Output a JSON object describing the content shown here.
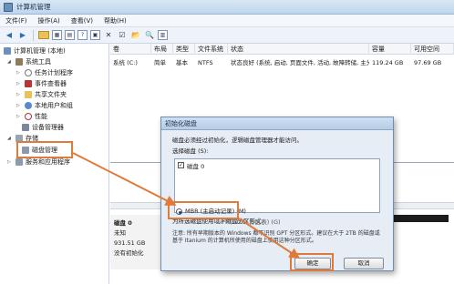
{
  "window": {
    "title": "计算机管理"
  },
  "menu": [
    "文件(F)",
    "操作(A)",
    "查看(V)",
    "帮助(H)"
  ],
  "tree": {
    "root": "计算机管理 (本地)",
    "system_tools": "系统工具",
    "task_scheduler": "任务计划程序",
    "event_viewer": "事件查看器",
    "shared_folders": "共享文件夹",
    "local_users": "本地用户和组",
    "performance": "性能",
    "device_manager": "设备管理器",
    "storage": "存储",
    "disk_management": "磁盘管理",
    "services": "服务和应用程序"
  },
  "list": {
    "headers": [
      "卷",
      "布局",
      "类型",
      "文件系统",
      "状态",
      "容量",
      "可用空间"
    ],
    "row": [
      "系统 (C:)",
      "简单",
      "基本",
      "NTFS",
      "状态良好 (系统, 启动, 页面文件, 活动, 故障转储, 主分区)",
      "119.24 GB",
      "97.69 GB"
    ]
  },
  "disk": {
    "name": "磁盘 0",
    "type": "未知",
    "size": "931.51 GB",
    "status": "没有初始化"
  },
  "dialog": {
    "title": "初始化磁盘",
    "intro": "磁盘必须经过初始化，逻辑磁盘管理器才能访问。",
    "select_label": "选择磁盘 (S):",
    "disk_item": "磁盘 0",
    "style_label": "为所选磁盘使用以下磁盘分区形式:",
    "mbr": "MBR (主启动记录) (M)",
    "gpt": "GPT (GUID 分区表) (G)",
    "note": "注意: 所有早期版本的 Windows 都不识别 GPT 分区形式。建议在大于 2TB 的磁盘或基于 Itanium 的计算机所使用的磁盘上使用这种分区形式。",
    "ok": "确定",
    "cancel": "取消"
  },
  "colors": {
    "highlight": "#e07a3b"
  }
}
